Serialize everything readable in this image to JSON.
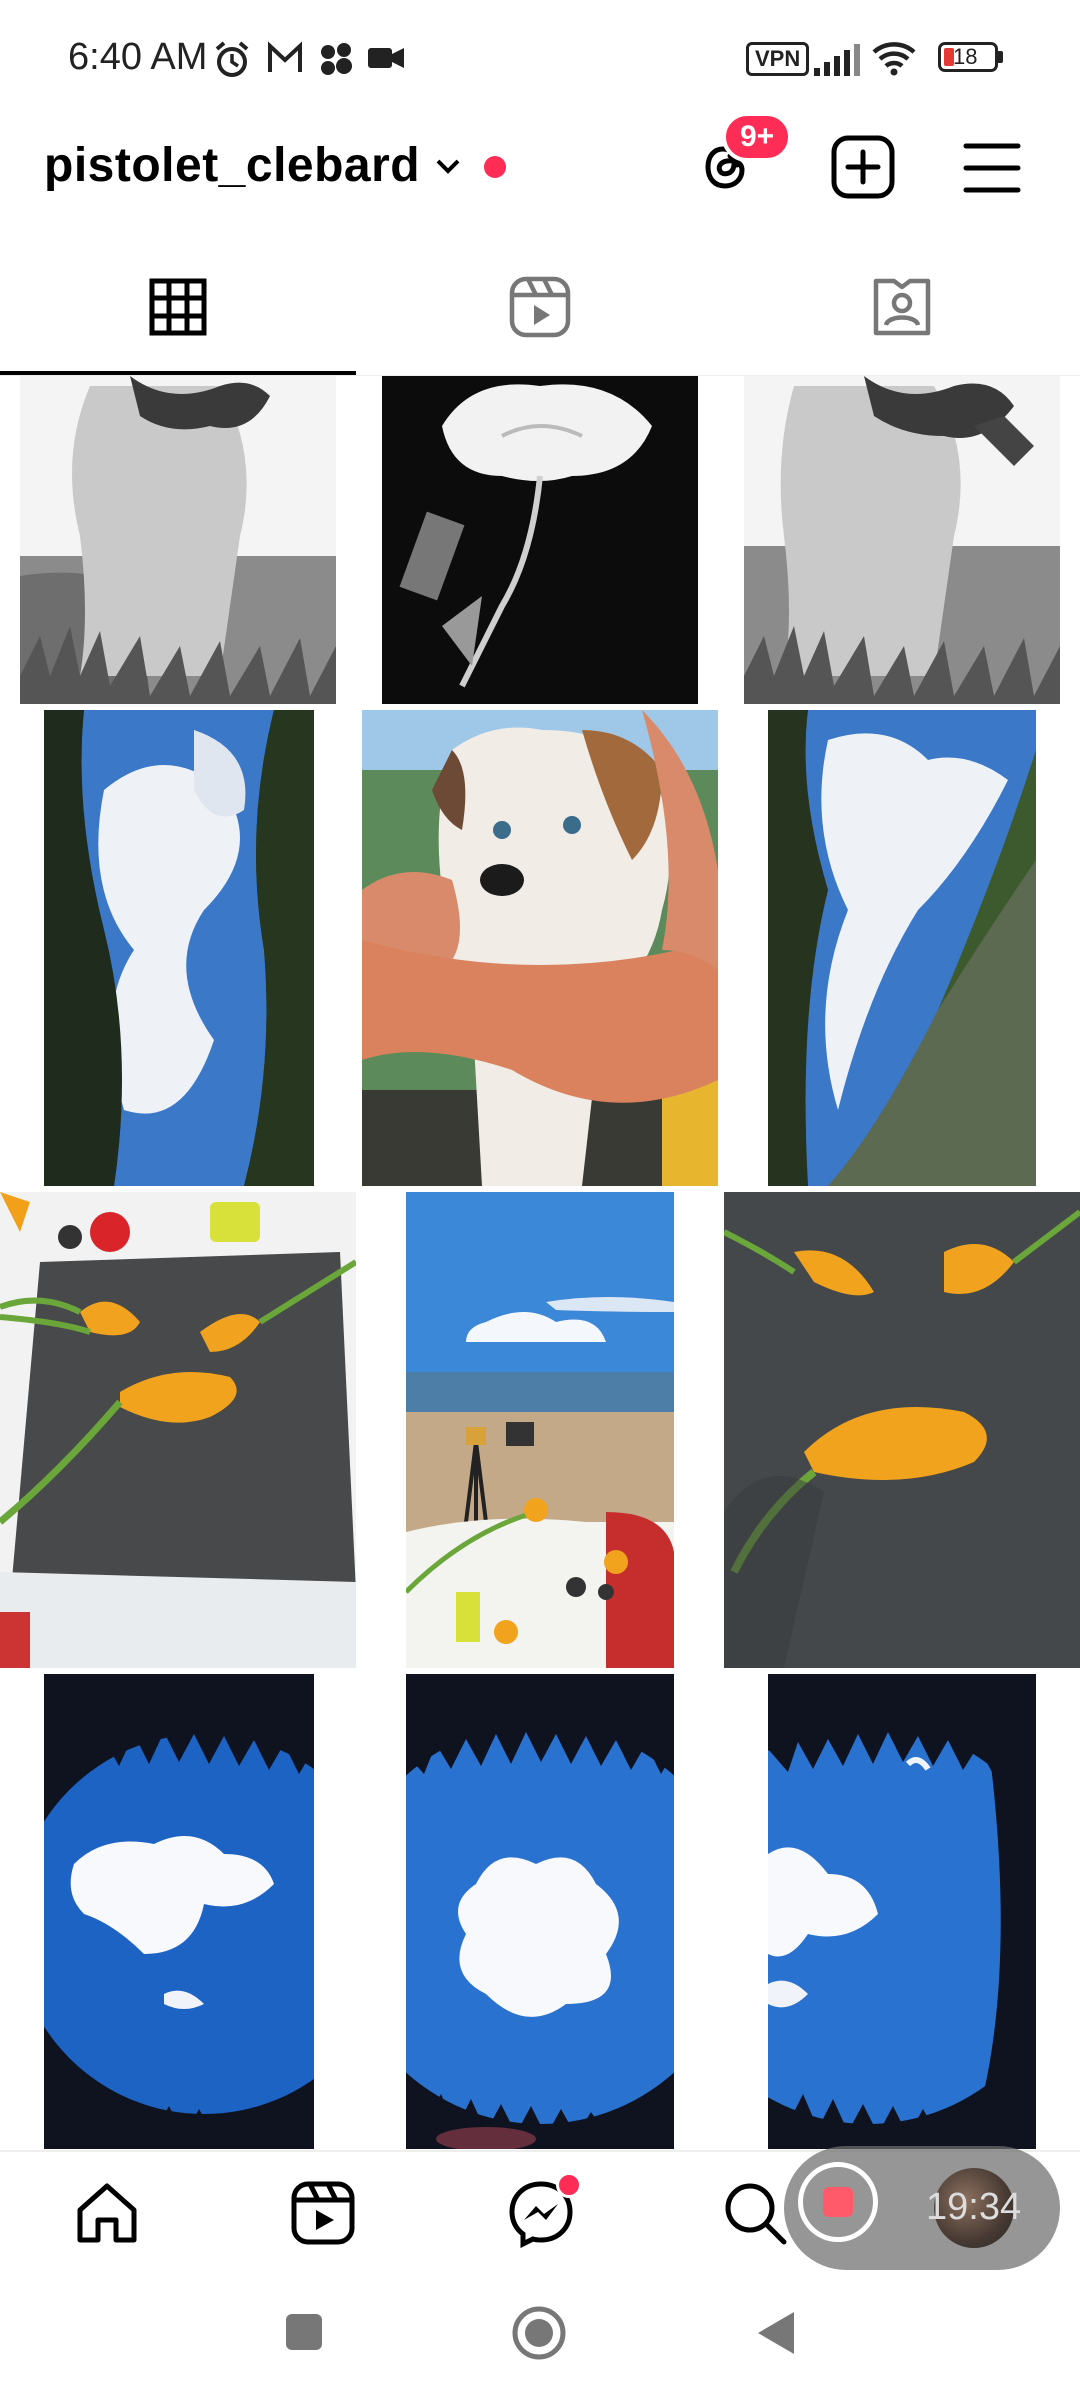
{
  "status_bar": {
    "time": "6:40 AM",
    "vpn": "VPN",
    "battery": "18"
  },
  "profile": {
    "username": "pistolet_clebard",
    "notification_badge": "9+"
  },
  "tabs": [
    "grid-posts",
    "reels",
    "tagged"
  ],
  "grid": {
    "rows": 4,
    "columns": 3,
    "posts": [
      {
        "id": 1,
        "subject": "black and white nude back in grass"
      },
      {
        "id": 2,
        "subject": "black and white white flower"
      },
      {
        "id": 3,
        "subject": "black and white nude back in grass"
      },
      {
        "id": 4,
        "subject": "sky between cliffs"
      },
      {
        "id": 5,
        "subject": "puppy held in arms"
      },
      {
        "id": 6,
        "subject": "sky between cliffs"
      },
      {
        "id": 7,
        "subject": "orange flowers on grey cloth"
      },
      {
        "id": 8,
        "subject": "beach with camera tripod"
      },
      {
        "id": 9,
        "subject": "orange flowers on grey cloth"
      },
      {
        "id": 10,
        "subject": "fisheye sky with clouds"
      },
      {
        "id": 11,
        "subject": "fisheye sky with clouds"
      },
      {
        "id": 12,
        "subject": "fisheye sky with clouds"
      }
    ]
  },
  "recorder": {
    "time": "19:34"
  },
  "colors": {
    "accent_red": "#ff2d55",
    "text": "#000000"
  }
}
